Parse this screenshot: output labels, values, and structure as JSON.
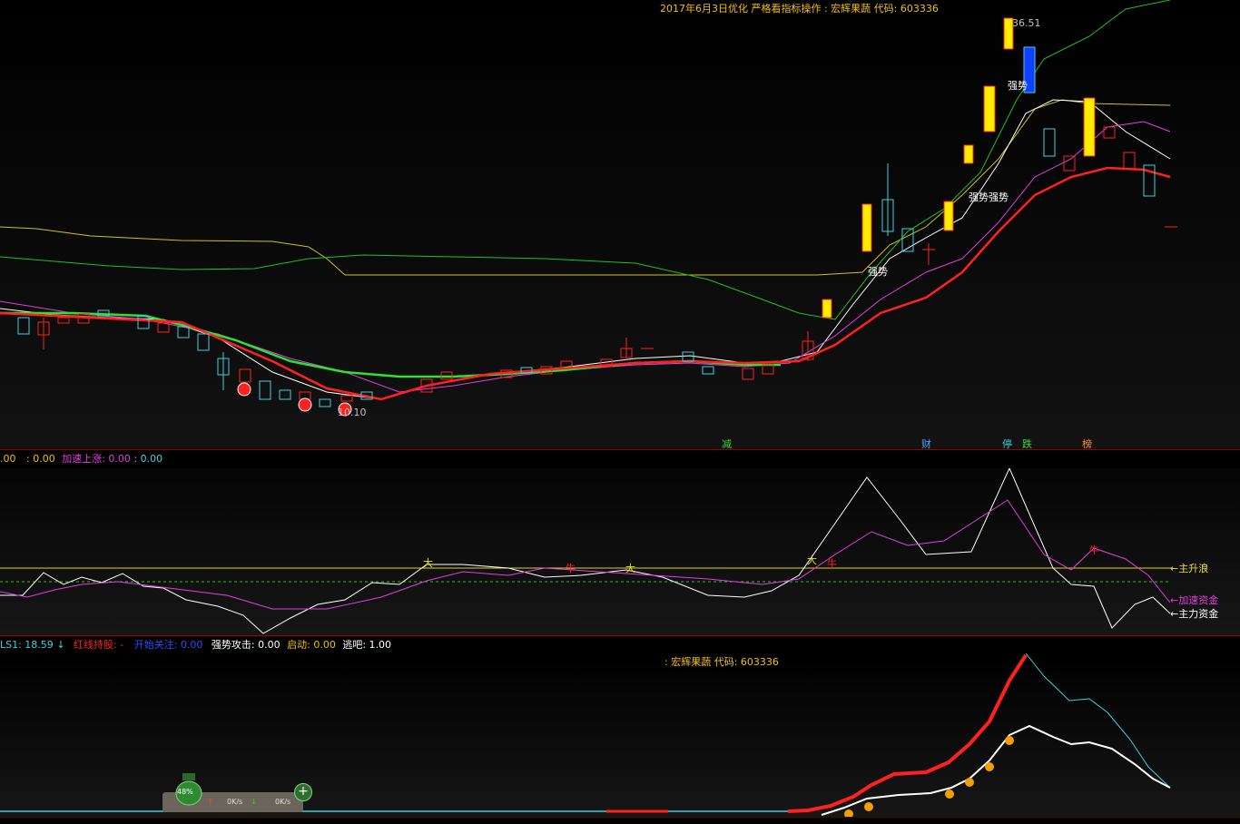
{
  "top_title": "2017年6月3日优化 严格看指标操作 : 宏辉果蔬 代码: 603336",
  "price_high_label": "36.51",
  "price_low_label": "10.10",
  "strength_labels": [
    "强势",
    "强势",
    "强势强势"
  ],
  "signals": {
    "reduce": "减",
    "finance": "财",
    "halt": "停",
    "drop": "跌",
    "rank": "榜"
  },
  "indicator_header": {
    "v1": ".00",
    "v2": ": 0.00",
    "accel_label": "加速上涨:",
    "accel_value": "0.00",
    "v3": ": 0.00"
  },
  "indicator_lines": {
    "main_wave": "←主升浪",
    "accel_fund": "←加速资金",
    "main_fund": "←主力资金"
  },
  "marks": {
    "da": "大",
    "niu": "牛"
  },
  "status_bar": {
    "ls1": "LS1: 18.59",
    "ls1_arrow": "↓",
    "red_hold": "红线持股: -",
    "start_watch_label": "开始关注:",
    "start_watch_value": "0.00",
    "strong_attack": "强势攻击: 0.00",
    "launch_label": "启动:",
    "launch_value": "0.00",
    "escape": "逃吧: 1.00"
  },
  "bottom_title": ": 宏辉果蔬 代码: 603336",
  "network_widget": {
    "percent": "48%",
    "up_speed": "0K/s",
    "down_speed": "0K/s"
  },
  "colors": {
    "up": "#ff2020",
    "down": "#3fd0e0",
    "title": "#f0c000",
    "magenta": "#e040e0",
    "green": "#30e030"
  }
}
